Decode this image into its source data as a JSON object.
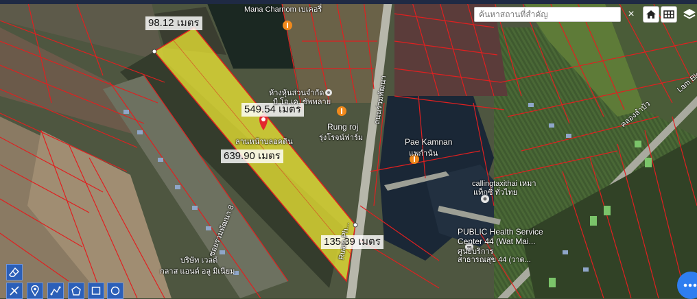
{
  "search": {
    "placeholder": "ค้นหาสถานที่สำคัญ",
    "clear_symbol": "×"
  },
  "toolbar": {
    "home_icon": "home-icon",
    "grid_icon": "grid-icon",
    "layers_icon": "layers-icon"
  },
  "measurements": {
    "top_edge": "98.12 เมตร",
    "long_edge_upper": "549.54 เมตร",
    "long_edge_lower": "639.90 เมตร",
    "bottom_edge": "135.39 เมตร"
  },
  "map_labels": {
    "rung_roj": "Rung roj",
    "rung_roj_th": "รุ่งโรจน์ฟาร์ม",
    "pae_kamnan": "Pae Kamnan",
    "pae_kamnan_th": "แพกำนัน",
    "shop1": "ห้างหุ้นส่วนจำกัด",
    "shop2": "บี.โอ.เค. ซัพพลาย",
    "taxi1": "callingtaxithai เหมา",
    "taxi2": "แท็กซี่ ทั่วไทย",
    "health1": "PUBLIC Health Service",
    "health2": "Center 44 (Wat Mai...",
    "health3": "ศูนย์บริการ",
    "health4": "สาธารณสุข 44 (วาด...",
    "road_ruam": "Ruam Ph...",
    "road_ruam_th": "ถนนร่วมพัฒนา",
    "road_lam": "Lam Blok",
    "road_lam_th": "คลองลำบัว",
    "top1": "Mana Charnom เบเคอรี่",
    "company1": "บริษัท เวลด์",
    "company2": "กลาส แอนด์ อลู มิเนียม",
    "soi": "ซอยร่วมพัฒนา 8",
    "plot_caption": "ลานหน้าบลอคดิน"
  },
  "colors": {
    "parcel_fill": "#e8e233",
    "parcel_border": "#e02020",
    "marker": "#e3262e",
    "tool_bg": "#2b5fb8",
    "fab": "#2f7ef0"
  },
  "tools": [
    {
      "name": "eraser-tool-button",
      "icon": "eraser-icon"
    },
    {
      "name": "measure-tool-button",
      "icon": "ruler-icon"
    },
    {
      "name": "marker-tool-button",
      "icon": "pin-icon"
    },
    {
      "name": "polyline-tool-button",
      "icon": "polyline-icon"
    },
    {
      "name": "polygon-tool-button",
      "icon": "polygon-icon"
    },
    {
      "name": "rectangle-tool-button",
      "icon": "rectangle-icon"
    },
    {
      "name": "circle-tool-button",
      "icon": "circle-icon"
    }
  ],
  "fab": {
    "icon": "more-icon"
  }
}
